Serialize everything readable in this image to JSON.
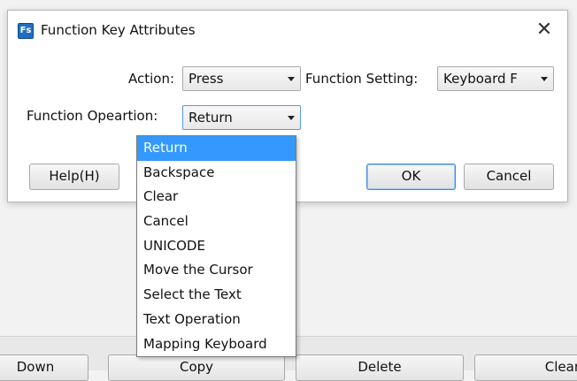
{
  "dialog": {
    "icon_text": "Fs",
    "title": "Function Key Attributes",
    "close_glyph": "✕",
    "action_label": "Action:",
    "action_value": "Press",
    "function_setting_label": "Function Setting:",
    "function_setting_value": "Keyboard F",
    "function_operation_label": "Function Opeartion:",
    "function_operation_value": "Return",
    "help_label": "Help(H)",
    "ok_label": "OK",
    "cancel_label": "Cancel"
  },
  "dropdown": {
    "selected_index": 0,
    "items": [
      "Return",
      "Backspace",
      "Clear",
      "Cancel",
      "UNICODE",
      "Move the Cursor",
      "Select the Text",
      "Text Operation",
      "Mapping Keyboard"
    ]
  },
  "parent": {
    "buttons": [
      "Down",
      "Copy",
      "Delete",
      "Clear"
    ]
  },
  "colors": {
    "selection": "#3399ff",
    "focus_border": "#5a9bd5",
    "icon_bg": "#1f6fc1"
  }
}
